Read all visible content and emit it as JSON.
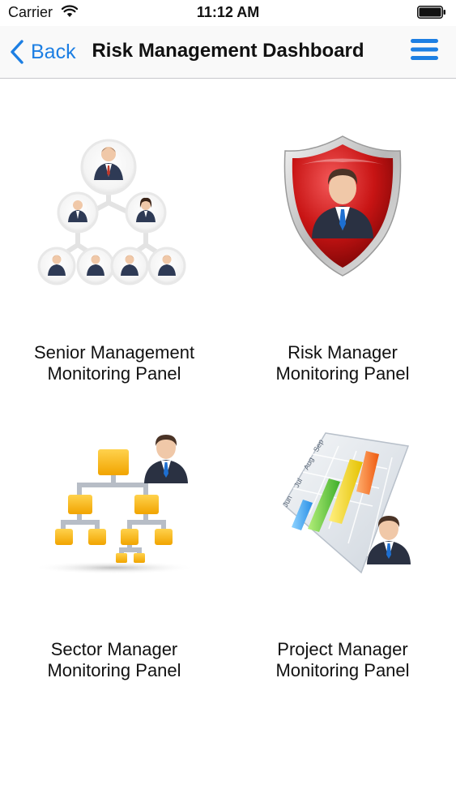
{
  "status_bar": {
    "carrier": "Carrier",
    "time": "11:12 AM"
  },
  "nav": {
    "back_label": "Back",
    "title": "Risk Management Dashboard",
    "accent_color": "#1d7fe3"
  },
  "tiles": [
    {
      "line1": "Senior Management",
      "line2": "Monitoring Panel",
      "icon": "org-hierarchy-people-icon"
    },
    {
      "line1": "Risk Manager",
      "line2": "Monitoring Panel",
      "icon": "shield-manager-icon"
    },
    {
      "line1": "Sector Manager",
      "line2": "Monitoring Panel",
      "icon": "org-chart-manager-icon"
    },
    {
      "line1": "Project Manager",
      "line2": "Monitoring Panel",
      "icon": "gantt-chart-manager-icon"
    }
  ],
  "gantt_months": [
    "Jun",
    "Jul",
    "Aug",
    "Sep"
  ]
}
